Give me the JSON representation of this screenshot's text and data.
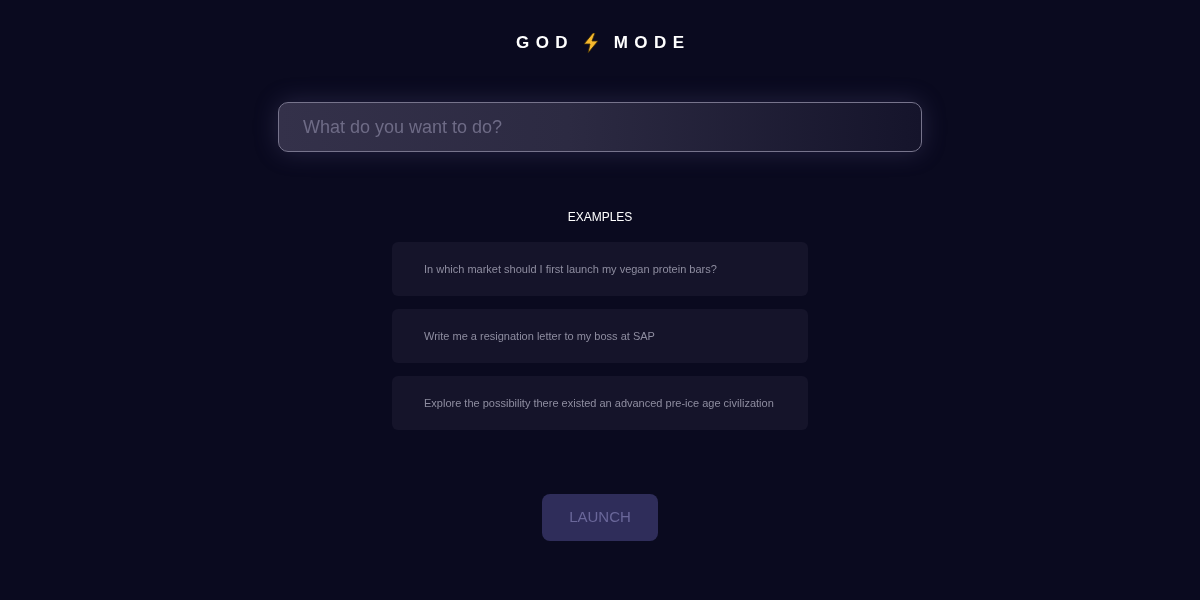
{
  "title": {
    "words": [
      "GOD",
      "MODE"
    ]
  },
  "prompt": {
    "placeholder": "What do you want to do?"
  },
  "examples": {
    "heading": "EXAMPLES",
    "items": [
      "In which market should I first launch my vegan protein bars?",
      "Write me a resignation letter to my boss at SAP",
      "Explore the possibility there existed an advanced pre-ice age civilization"
    ]
  },
  "launch_button": {
    "label": "LAUNCH",
    "disabled": true
  }
}
